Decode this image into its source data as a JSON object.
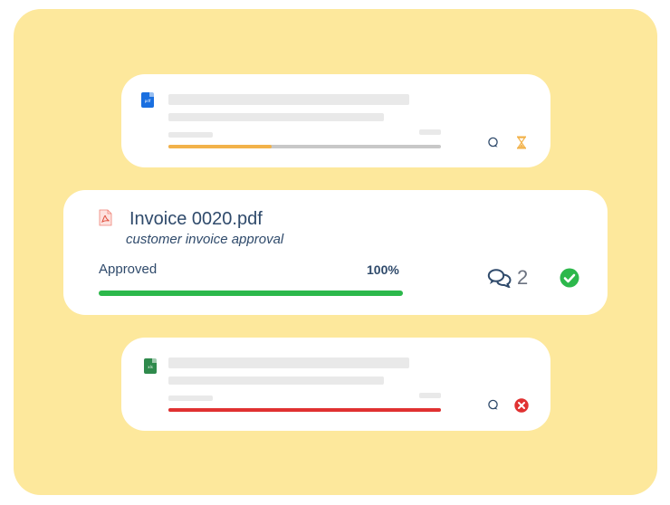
{
  "cards": [
    {
      "file_type": "pdf",
      "file_icon": "pdf-file-icon",
      "icon_color": "#1a6fe0",
      "progress_percent": 38,
      "progress_color": "#f2b24a",
      "status_icon": "hourglass-icon",
      "comment_icon": "comment-icon"
    },
    {
      "title": "Invoice 0020.pdf",
      "subtitle": "customer invoice approval",
      "status": "Approved",
      "percent": "100%",
      "progress_percent": 100,
      "progress_color": "#2cb84b",
      "comments_count": "2",
      "file_icon": "pdf-file-icon",
      "comment_icon": "comments-icon",
      "status_icon": "check-circle-icon"
    },
    {
      "file_type": "xls",
      "file_icon": "spreadsheet-file-icon",
      "icon_color": "#2f8a4c",
      "progress_percent": 100,
      "progress_color": "#e03131",
      "status_icon": "error-x-icon",
      "comment_icon": "comment-icon"
    }
  ],
  "colors": {
    "background": "#fde89c",
    "text": "#2f4a6b",
    "approved": "#2cb84b",
    "rejected": "#e03131",
    "pending": "#f2b24a"
  }
}
